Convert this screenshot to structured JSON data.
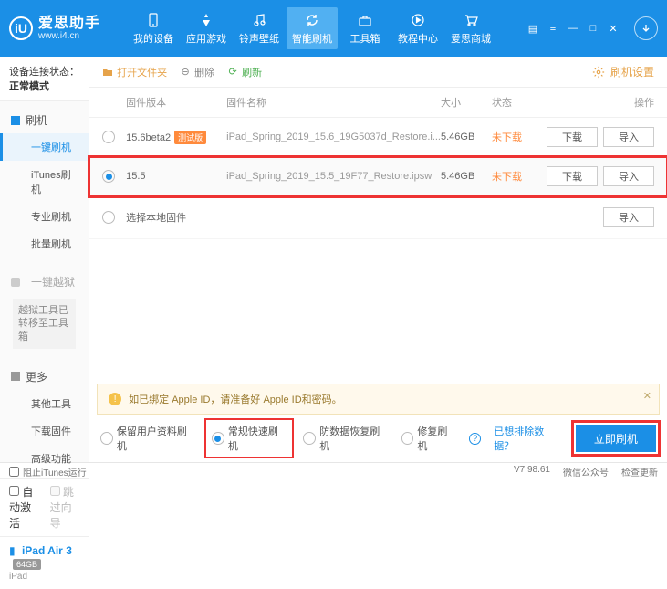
{
  "brand": {
    "title": "爱思助手",
    "url": "www.i4.cn",
    "logo_letter": "iU"
  },
  "nav": [
    {
      "label": "我的设备"
    },
    {
      "label": "应用游戏"
    },
    {
      "label": "铃声壁纸"
    },
    {
      "label": "智能刷机"
    },
    {
      "label": "工具箱"
    },
    {
      "label": "教程中心"
    },
    {
      "label": "爱思商城"
    }
  ],
  "conn": {
    "label": "设备连接状态：",
    "mode": "正常模式"
  },
  "sidebar": {
    "flash_hdr": "刷机",
    "flash_items": [
      "一键刷机",
      "iTunes刷机",
      "专业刷机",
      "批量刷机"
    ],
    "jail_hdr": "一键越狱",
    "jail_note": "越狱工具已转移至工具箱",
    "more_hdr": "更多",
    "more_items": [
      "其他工具",
      "下载固件",
      "高级功能"
    ],
    "auto_activate": "自动激活",
    "skip_guide": "跳过向导",
    "device_name": "iPad Air 3",
    "device_cap": "64GB",
    "device_sub": "iPad"
  },
  "toolbar": {
    "open": "打开文件夹",
    "delete": "删除",
    "refresh": "刷新",
    "settings": "刷机设置"
  },
  "thead": {
    "ver": "固件版本",
    "name": "固件名称",
    "size": "大小",
    "status": "状态",
    "ops": "操作"
  },
  "rows": [
    {
      "ver": "15.6beta2",
      "beta": "测试版",
      "name": "iPad_Spring_2019_15.6_19G5037d_Restore.i...",
      "size": "5.46GB",
      "status": "未下载",
      "selected": false
    },
    {
      "ver": "15.5",
      "beta": "",
      "name": "iPad_Spring_2019_15.5_19F77_Restore.ipsw",
      "size": "5.46GB",
      "status": "未下载",
      "selected": true
    }
  ],
  "local_row": "选择本地固件",
  "btns": {
    "download": "下载",
    "import": "导入"
  },
  "alert": "如已绑定 Apple ID，请准备好 Apple ID和密码。",
  "options": {
    "keep": "保留用户资料刷机",
    "normal": "常规快速刷机",
    "anti": "防数据恢复刷机",
    "repair": "修复刷机",
    "exclude": "已想排除数据？",
    "go": "立即刷机"
  },
  "footer": {
    "block": "阻止iTunes运行",
    "ver": "V7.98.61",
    "wx": "微信公众号",
    "update": "检查更新"
  }
}
